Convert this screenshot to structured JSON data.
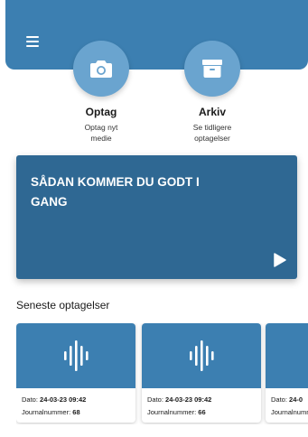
{
  "header": {
    "menu_icon": "hamburger-menu-icon"
  },
  "actions": [
    {
      "title": "Optag",
      "subtitle": "Optag nyt medie",
      "icon": "camera-icon"
    },
    {
      "title": "Arkiv",
      "subtitle": "Se tidligere optagelser",
      "icon": "archive-box-icon"
    }
  ],
  "hero": {
    "title": "SÅDAN KOMMER DU GODT I GANG",
    "icon": "play-icon"
  },
  "recent": {
    "title": "Seneste optagelser",
    "date_label": "Dato:",
    "journal_label": "Journalnummer:",
    "items": [
      {
        "date": "24-03-23 09:42",
        "journal": "68"
      },
      {
        "date": "24-03-23 09:42",
        "journal": "66"
      },
      {
        "date": "24-0",
        "journal": ""
      }
    ]
  },
  "colors": {
    "primary": "#3c7fb1",
    "circle": "#6aa4cf",
    "hero": "#2f6893"
  }
}
